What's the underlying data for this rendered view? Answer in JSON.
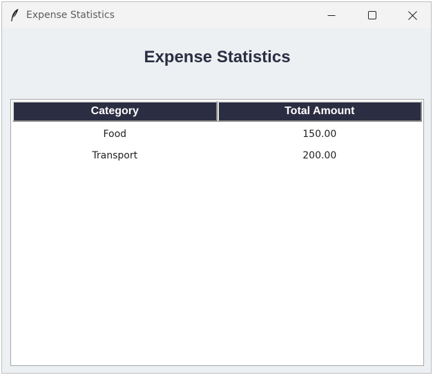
{
  "window": {
    "title": "Expense Statistics",
    "icons": {
      "app": "feather-icon",
      "minimize": "minimize-icon",
      "maximize": "maximize-icon",
      "close": "close-icon"
    }
  },
  "main": {
    "heading": "Expense Statistics"
  },
  "table": {
    "columns": [
      "Category",
      "Total Amount"
    ],
    "rows": [
      [
        "Food",
        "150.00"
      ],
      [
        "Transport",
        "200.00"
      ]
    ]
  },
  "colors": {
    "header_bg": "#2b2d42",
    "window_bg": "#edf0f2"
  }
}
